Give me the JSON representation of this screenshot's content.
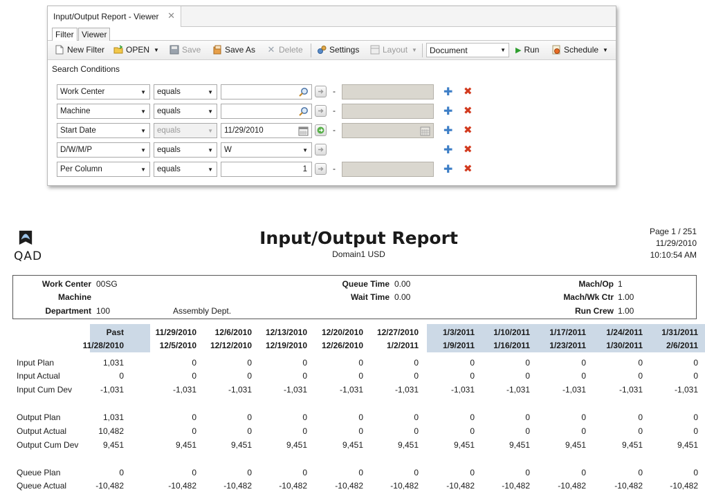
{
  "viewer": {
    "tab_title": "Input/Output Report - Viewer",
    "close_glyph": "✕",
    "sub_tabs": [
      "Filter",
      "Viewer"
    ],
    "toolbar": {
      "new_filter": "New Filter",
      "open": "OPEN",
      "save": "Save",
      "save_as": "Save As",
      "delete": "Delete",
      "settings": "Settings",
      "layout": "Layout",
      "document": "Document",
      "run": "Run",
      "schedule": "Schedule"
    },
    "search_conditions_label": "Search Conditions",
    "conditions": [
      {
        "field": "Work Center",
        "operator": "equals",
        "value": "",
        "to": "",
        "enabled": true
      },
      {
        "field": "Machine",
        "operator": "equals",
        "value": "",
        "to": "",
        "enabled": true
      },
      {
        "field": "Start Date",
        "operator": "equals",
        "value": "11/29/2010",
        "to": "",
        "enabled": false
      },
      {
        "field": "D/W/M/P",
        "operator": "equals",
        "value": "W",
        "to": "",
        "enabled": true
      },
      {
        "field": "Per Column",
        "operator": "equals",
        "value": "1",
        "to": "",
        "enabled": true
      }
    ],
    "range_dash": "-"
  },
  "report": {
    "logo_text": "QAD",
    "title": "Input/Output Report",
    "subtitle": "Domain1  USD",
    "page": "Page 1 / 251",
    "date": "11/29/2010",
    "time": "10:10:54 AM",
    "header": {
      "work_center_label": "Work Center",
      "work_center": "00SG",
      "machine_label": "Machine",
      "machine": "",
      "department_label": "Department",
      "department": "100",
      "department_desc": "Assembly Dept.",
      "queue_time_label": "Queue Time",
      "queue_time": "0.00",
      "wait_time_label": "Wait Time",
      "wait_time": "0.00",
      "mach_op_label": "Mach/Op",
      "mach_op": "1",
      "mach_wkctr_label": "Mach/Wk Ctr",
      "mach_wkctr": "1.00",
      "run_crew_label": "Run Crew",
      "run_crew": "1.00"
    },
    "columns": [
      {
        "top": "Past",
        "bottom": "11/28/2010"
      },
      {
        "top": "11/29/2010",
        "bottom": "12/5/2010"
      },
      {
        "top": "12/6/2010",
        "bottom": "12/12/2010"
      },
      {
        "top": "12/13/2010",
        "bottom": "12/19/2010"
      },
      {
        "top": "12/20/2010",
        "bottom": "12/26/2010"
      },
      {
        "top": "12/27/2010",
        "bottom": "1/2/2011"
      },
      {
        "top": "1/3/2011",
        "bottom": "1/9/2011"
      },
      {
        "top": "1/10/2011",
        "bottom": "1/16/2011"
      },
      {
        "top": "1/17/2011",
        "bottom": "1/23/2011"
      },
      {
        "top": "1/24/2011",
        "bottom": "1/30/2011"
      },
      {
        "top": "1/31/2011",
        "bottom": "2/6/2011"
      }
    ],
    "rows": [
      {
        "label": "Input Plan",
        "values": [
          "1,031",
          "0",
          "0",
          "0",
          "0",
          "0",
          "0",
          "0",
          "0",
          "0",
          "0"
        ]
      },
      {
        "label": "Input Actual",
        "values": [
          "0",
          "0",
          "0",
          "0",
          "0",
          "0",
          "0",
          "0",
          "0",
          "0",
          "0"
        ]
      },
      {
        "label": "Input Cum Dev",
        "values": [
          "-1,031",
          "-1,031",
          "-1,031",
          "-1,031",
          "-1,031",
          "-1,031",
          "-1,031",
          "-1,031",
          "-1,031",
          "-1,031",
          "-1,031"
        ]
      },
      {
        "label": "Output Plan",
        "values": [
          "1,031",
          "0",
          "0",
          "0",
          "0",
          "0",
          "0",
          "0",
          "0",
          "0",
          "0"
        ]
      },
      {
        "label": "Output Actual",
        "values": [
          "10,482",
          "0",
          "0",
          "0",
          "0",
          "0",
          "0",
          "0",
          "0",
          "0",
          "0"
        ]
      },
      {
        "label": "Output Cum Dev",
        "values": [
          "9,451",
          "9,451",
          "9,451",
          "9,451",
          "9,451",
          "9,451",
          "9,451",
          "9,451",
          "9,451",
          "9,451",
          "9,451"
        ]
      },
      {
        "label": "Queue Plan",
        "values": [
          "0",
          "0",
          "0",
          "0",
          "0",
          "0",
          "0",
          "0",
          "0",
          "0",
          "0"
        ]
      },
      {
        "label": "Queue Actual",
        "values": [
          "-10,482",
          "-10,482",
          "-10,482",
          "-10,482",
          "-10,482",
          "-10,482",
          "-10,482",
          "-10,482",
          "-10,482",
          "-10,482",
          "-10,482"
        ]
      }
    ],
    "colors": {
      "header_band": "#ccd9e6",
      "add_icon": "#3d7ec6",
      "remove_icon": "#d23a1e",
      "run_icon": "#2e9e2e"
    }
  }
}
